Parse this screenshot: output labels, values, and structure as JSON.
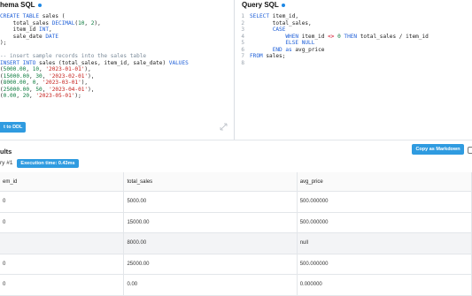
{
  "schema": {
    "title": "hema SQL",
    "code_lines": [
      [
        [
          "kw",
          "CREATE TABLE "
        ],
        [
          "plain",
          "sales ("
        ]
      ],
      [
        [
          "plain",
          "    total_sales "
        ],
        [
          "kw",
          "DECIMAL"
        ],
        [
          "plain",
          "("
        ],
        [
          "num",
          "10"
        ],
        [
          "plain",
          ", "
        ],
        [
          "num",
          "2"
        ],
        [
          "plain",
          "),"
        ]
      ],
      [
        [
          "plain",
          "    item_id "
        ],
        [
          "kw",
          "INT"
        ],
        [
          "plain",
          ","
        ]
      ],
      [
        [
          "plain",
          "    sale_date "
        ],
        [
          "kw",
          "DATE"
        ]
      ],
      [
        [
          "plain",
          ");"
        ]
      ],
      [
        [
          "plain",
          ""
        ]
      ],
      [
        [
          "cmt",
          "-- insert sample records into the sales table"
        ]
      ],
      [
        [
          "kw",
          "INSERT INTO "
        ],
        [
          "plain",
          "sales (total_sales, item_id, sale_date) "
        ],
        [
          "kw",
          "VALUES"
        ]
      ],
      [
        [
          "plain",
          "("
        ],
        [
          "num",
          "5000.00"
        ],
        [
          "plain",
          ", "
        ],
        [
          "num",
          "10"
        ],
        [
          "plain",
          ", "
        ],
        [
          "str",
          "'2023-01-01'"
        ],
        [
          "plain",
          "),"
        ]
      ],
      [
        [
          "plain",
          "("
        ],
        [
          "num",
          "15000.00"
        ],
        [
          "plain",
          ", "
        ],
        [
          "num",
          "30"
        ],
        [
          "plain",
          ", "
        ],
        [
          "str",
          "'2023-02-01'"
        ],
        [
          "plain",
          "),"
        ]
      ],
      [
        [
          "plain",
          "("
        ],
        [
          "num",
          "8000.00"
        ],
        [
          "plain",
          ", "
        ],
        [
          "num",
          "0"
        ],
        [
          "plain",
          ", "
        ],
        [
          "str",
          "'2023-03-01'"
        ],
        [
          "plain",
          "),"
        ]
      ],
      [
        [
          "plain",
          "("
        ],
        [
          "num",
          "25000.00"
        ],
        [
          "plain",
          ", "
        ],
        [
          "num",
          "50"
        ],
        [
          "plain",
          ", "
        ],
        [
          "str",
          "'2023-04-01'"
        ],
        [
          "plain",
          "),"
        ]
      ],
      [
        [
          "plain",
          "("
        ],
        [
          "num",
          "0.00"
        ],
        [
          "plain",
          ", "
        ],
        [
          "num",
          "20"
        ],
        [
          "plain",
          ", "
        ],
        [
          "str",
          "'2023-05-01'"
        ],
        [
          "plain",
          ");"
        ]
      ]
    ],
    "button": "t to DDL"
  },
  "query": {
    "title": "Query SQL",
    "line_numbers": [
      "1",
      "2",
      "3",
      "4",
      "5",
      "6",
      "7",
      "8"
    ],
    "code_lines": [
      [
        [
          "kw",
          "SELECT "
        ],
        [
          "plain",
          "item_id,"
        ]
      ],
      [
        [
          "plain",
          "       total_sales,"
        ]
      ],
      [
        [
          "plain",
          "       "
        ],
        [
          "kw",
          "CASE"
        ]
      ],
      [
        [
          "plain",
          "           "
        ],
        [
          "kw",
          "WHEN "
        ],
        [
          "plain",
          "item_id "
        ],
        [
          "op",
          "<>"
        ],
        [
          "plain",
          " "
        ],
        [
          "num",
          "0"
        ],
        [
          "plain",
          " "
        ],
        [
          "kw",
          "THEN "
        ],
        [
          "plain",
          "total_sales / item_id"
        ]
      ],
      [
        [
          "plain",
          "           "
        ],
        [
          "kw",
          "ELSE "
        ],
        [
          "kw",
          "NULL"
        ]
      ],
      [
        [
          "plain",
          "       "
        ],
        [
          "kw",
          "END "
        ],
        [
          "kw",
          "as "
        ],
        [
          "plain",
          "avg_price"
        ]
      ],
      [
        [
          "kw",
          "FROM "
        ],
        [
          "plain",
          "sales;"
        ]
      ],
      [
        [
          "plain",
          ""
        ]
      ]
    ]
  },
  "results": {
    "title": "ults",
    "copy_button": "Copy as Markdown",
    "query_tab": "ry #1",
    "exec_time": "Execution time: 0.43ms",
    "columns": [
      "em_id",
      "total_sales",
      "avg_price"
    ],
    "rows": [
      [
        "0",
        "5000.00",
        "500.000000"
      ],
      [
        "0",
        "15000.00",
        "500.000000"
      ],
      [
        "",
        "8000.00",
        "null"
      ],
      [
        "0",
        "25000.00",
        "500.000000"
      ],
      [
        "0",
        "0.00",
        "0.000000"
      ]
    ]
  }
}
